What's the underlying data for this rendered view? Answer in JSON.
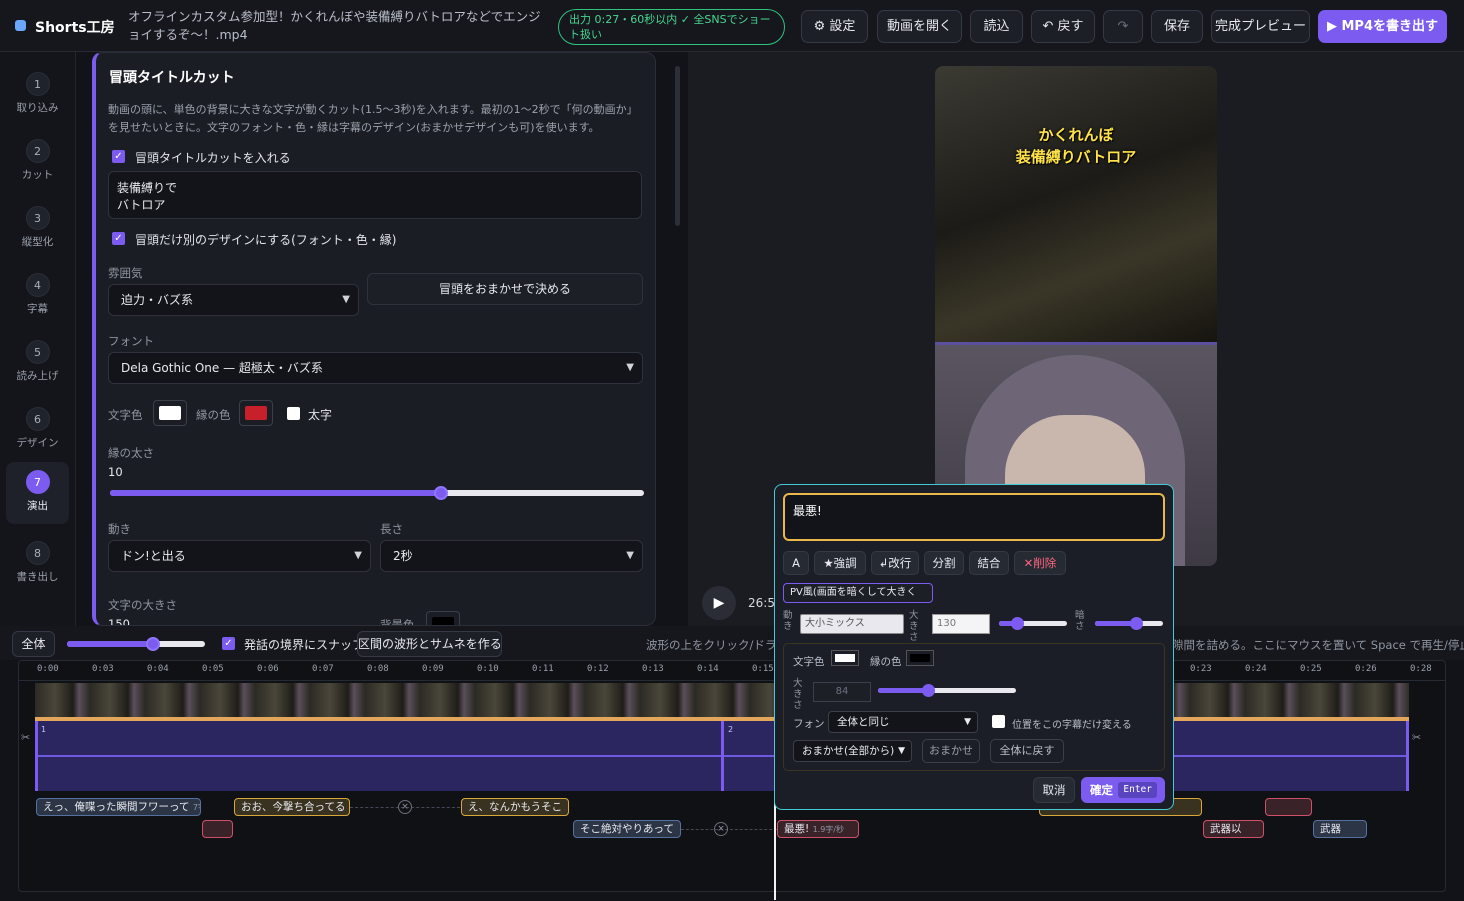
{
  "app": {
    "name": "Shorts工房",
    "filename": "オフラインカスタム参加型！かくれんぼや装備縛りバトロアなどでエンジョイするぞ〜！.mp4",
    "status": "出力 0:27・60秒以内 ✓ 全SNSでショート扱い"
  },
  "toolbar": {
    "settings": "⚙ 設定",
    "open": "動画を開く",
    "load": "読込",
    "undo": "↶ 戻す",
    "redo": "↷",
    "save": "保存",
    "preview": "完成プレビュー",
    "export": "▶ MP4を書き出す"
  },
  "steps": [
    {
      "num": "1",
      "label": "取り込み"
    },
    {
      "num": "2",
      "label": "カット"
    },
    {
      "num": "3",
      "label": "縦型化"
    },
    {
      "num": "4",
      "label": "字幕"
    },
    {
      "num": "5",
      "label": "読み上げ"
    },
    {
      "num": "6",
      "label": "デザイン"
    },
    {
      "num": "7",
      "label": "演出",
      "active": true
    },
    {
      "num": "8",
      "label": "書き出し"
    }
  ],
  "panel": {
    "title": "冒頭タイトルカット",
    "desc": "動画の頭に、単色の背景に大きな文字が動くカット(1.5〜3秒)を入れます。最初の1〜2秒で「何の動画か」を見せたいときに。文字のフォント・色・縁は字幕のデザイン(おまかせデザインも可)を使います。",
    "insert_label": "冒頭タイトルカットを入れる",
    "title_text": "装備縛りで\nバトロア",
    "custom_design_label": "冒頭だけ別のデザインにする(フォント・色・縁)",
    "mood_label": "雰囲気",
    "mood_value": "迫力・バズ系",
    "auto_btn": "冒頭をおまかせで決める",
    "font_label": "フォント",
    "font_value": "Dela Gothic One — 超極太・バズ系",
    "text_color_label": "文字色",
    "edge_color_label": "縁の色",
    "bold_label": "太字",
    "text_color": "#ffffff",
    "edge_color": "#c8202a",
    "edge_width_label": "縁の太さ",
    "edge_width_value": "10",
    "edge_width_fraction": 0.62,
    "motion_label": "動き",
    "motion_value": "ドン!と出る",
    "length_label": "長さ",
    "length_value": "2秒",
    "size_label": "文字の大きさ",
    "size_value": "150",
    "bg_color_label": "背景色"
  },
  "preview": {
    "overlay_title": "かくれんぼ\n装備縛りバトロア",
    "time": "26:5"
  },
  "timeline_toolbar": {
    "all_btn": "全体",
    "snap_label": "発話の境界にスナップ",
    "gap_btn": "区間の波形とサムネを作る",
    "hint_left": "波形の上をクリック/ドラッグ",
    "hint_right": "隙間を詰める。ここにマウスを置いて Space で再生/停止。",
    "zoom_fraction": 0.62
  },
  "ruler_ticks": [
    "0:00",
    "0:03",
    "0:04",
    "0:05",
    "0:06",
    "0:07",
    "0:08",
    "0:09",
    "0:10",
    "0:11",
    "0:12",
    "0:13",
    "0:14",
    "0:15",
    "0:23",
    "0:24",
    "0:25",
    "0:26",
    "0:28"
  ],
  "segments": [
    "1",
    "2"
  ],
  "captions": {
    "c1": "えっ、俺喋った瞬間フワーって",
    "c1_sub": "7字/秒",
    "c2": "おお、今撃ち合ってる",
    "c3": "え、なんかもうそこ",
    "c4": "そこ絶対やりあって",
    "c5": "最悪!",
    "c5_sub": "1.9字/秒",
    "c6": "武器以",
    "c7": "武器"
  },
  "popup": {
    "text": "最悪!",
    "btn_a": "A",
    "btn_emph": "★強調",
    "btn_newline": "↲改行",
    "btn_split": "分割",
    "btn_merge": "結合",
    "btn_delete": "✕削除",
    "pv_mode": "PV風(画面を暗くして大きく",
    "motion_lbl": "動き",
    "motion_val": "大小ミックス",
    "size_lbl": "大きさ",
    "size_val": "130",
    "dark_lbl": "暗さ",
    "text_color_lbl": "文字色",
    "edge_color_lbl": "縁の色",
    "inner_size_lbl": "大きさ",
    "inner_size_val": "84",
    "font_lbl": "フォント",
    "font_val": "全体と同じ",
    "pos_lbl": "位置をこの字幕だけ変える",
    "auto_sel": "おまかせ(全部から)",
    "auto_btn": "おまかせ",
    "reset_btn": "全体に戻す",
    "cancel": "取消",
    "confirm": "確定",
    "confirm_key": "Enter",
    "size_fraction": 0.28,
    "dark_fraction": 0.62,
    "inner_size_fraction": 0.37
  }
}
